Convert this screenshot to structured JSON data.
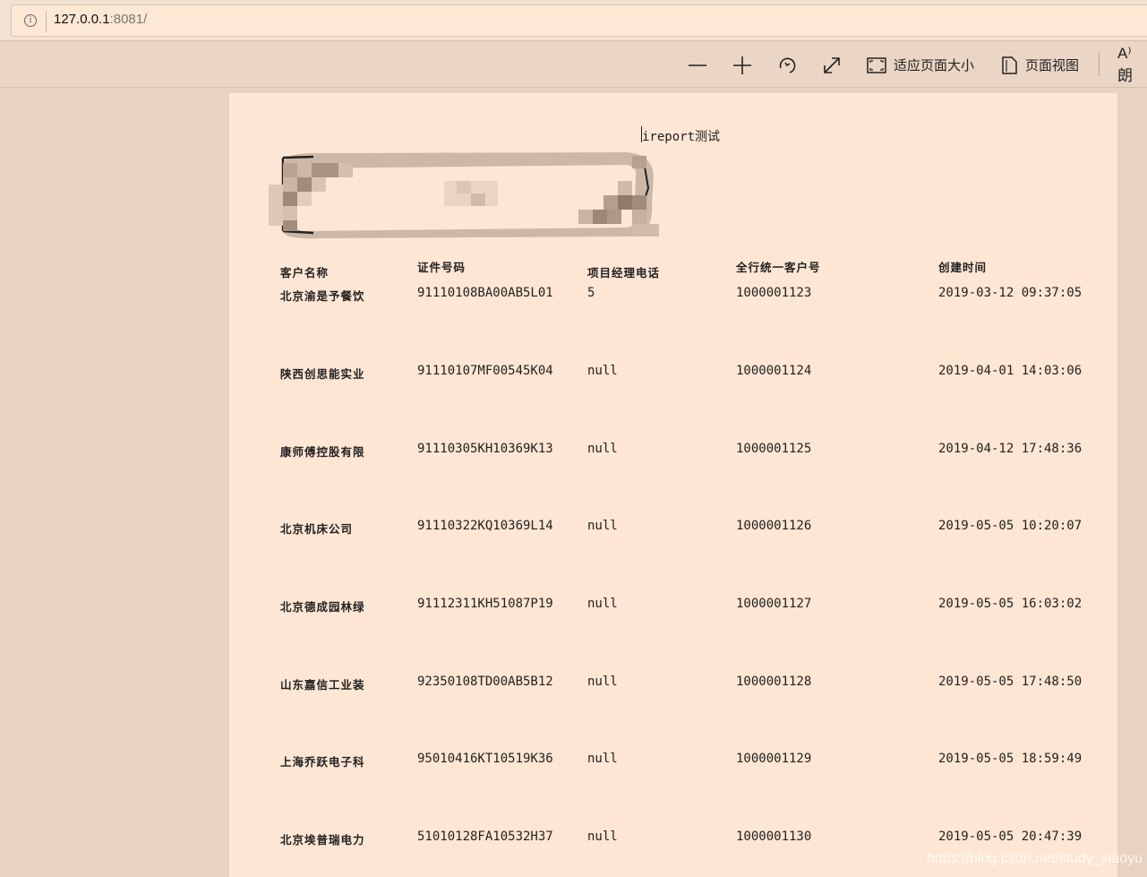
{
  "address_bar": {
    "host": "127.0.0.1",
    "port_path": ":8081/"
  },
  "toolbar": {
    "zoom_out": "zoom-out",
    "zoom_in": "zoom-in",
    "rotate": "rotate",
    "fit_to_page_label": "适应页面大小",
    "page_view_label": "页面视图",
    "read_aloud_label": "A⁾ 朗"
  },
  "report": {
    "title": "ireport测试",
    "headers": [
      "客户名称",
      "证件号码",
      "项目经理电话",
      "全行统一客户号",
      "创建时间"
    ],
    "rows": [
      [
        "北京渝是予餐饮",
        "91110108BA00AB5L01",
        "5",
        "1000001123",
        "2019-03-12 09:37:05"
      ],
      [
        "陕西创思能实业",
        "91110107MF00545K04",
        "null",
        "1000001124",
        "2019-04-01 14:03:06"
      ],
      [
        "康师傅控股有限",
        "91110305KH10369K13",
        "null",
        "1000001125",
        "2019-04-12 17:48:36"
      ],
      [
        "北京机床公司",
        "91110322KQ10369L14",
        "null",
        "1000001126",
        "2019-05-05 10:20:07"
      ],
      [
        "北京德成园林绿",
        "91112311KH51087P19",
        "null",
        "1000001127",
        "2019-05-05 16:03:02"
      ],
      [
        "山东嘉信工业装",
        "92350108TD00AB5B12",
        "null",
        "1000001128",
        "2019-05-05 17:48:50"
      ],
      [
        "上海乔跃电子科",
        "95010416KT10519K36",
        "null",
        "1000001129",
        "2019-05-05 18:59:49"
      ],
      [
        "北京埃普瑞电力",
        "51010128FA10532H37",
        "null",
        "1000001130",
        "2019-05-05 20:47:39"
      ]
    ]
  },
  "watermark": "https://blog.csdn.net/study_xiaoyu"
}
